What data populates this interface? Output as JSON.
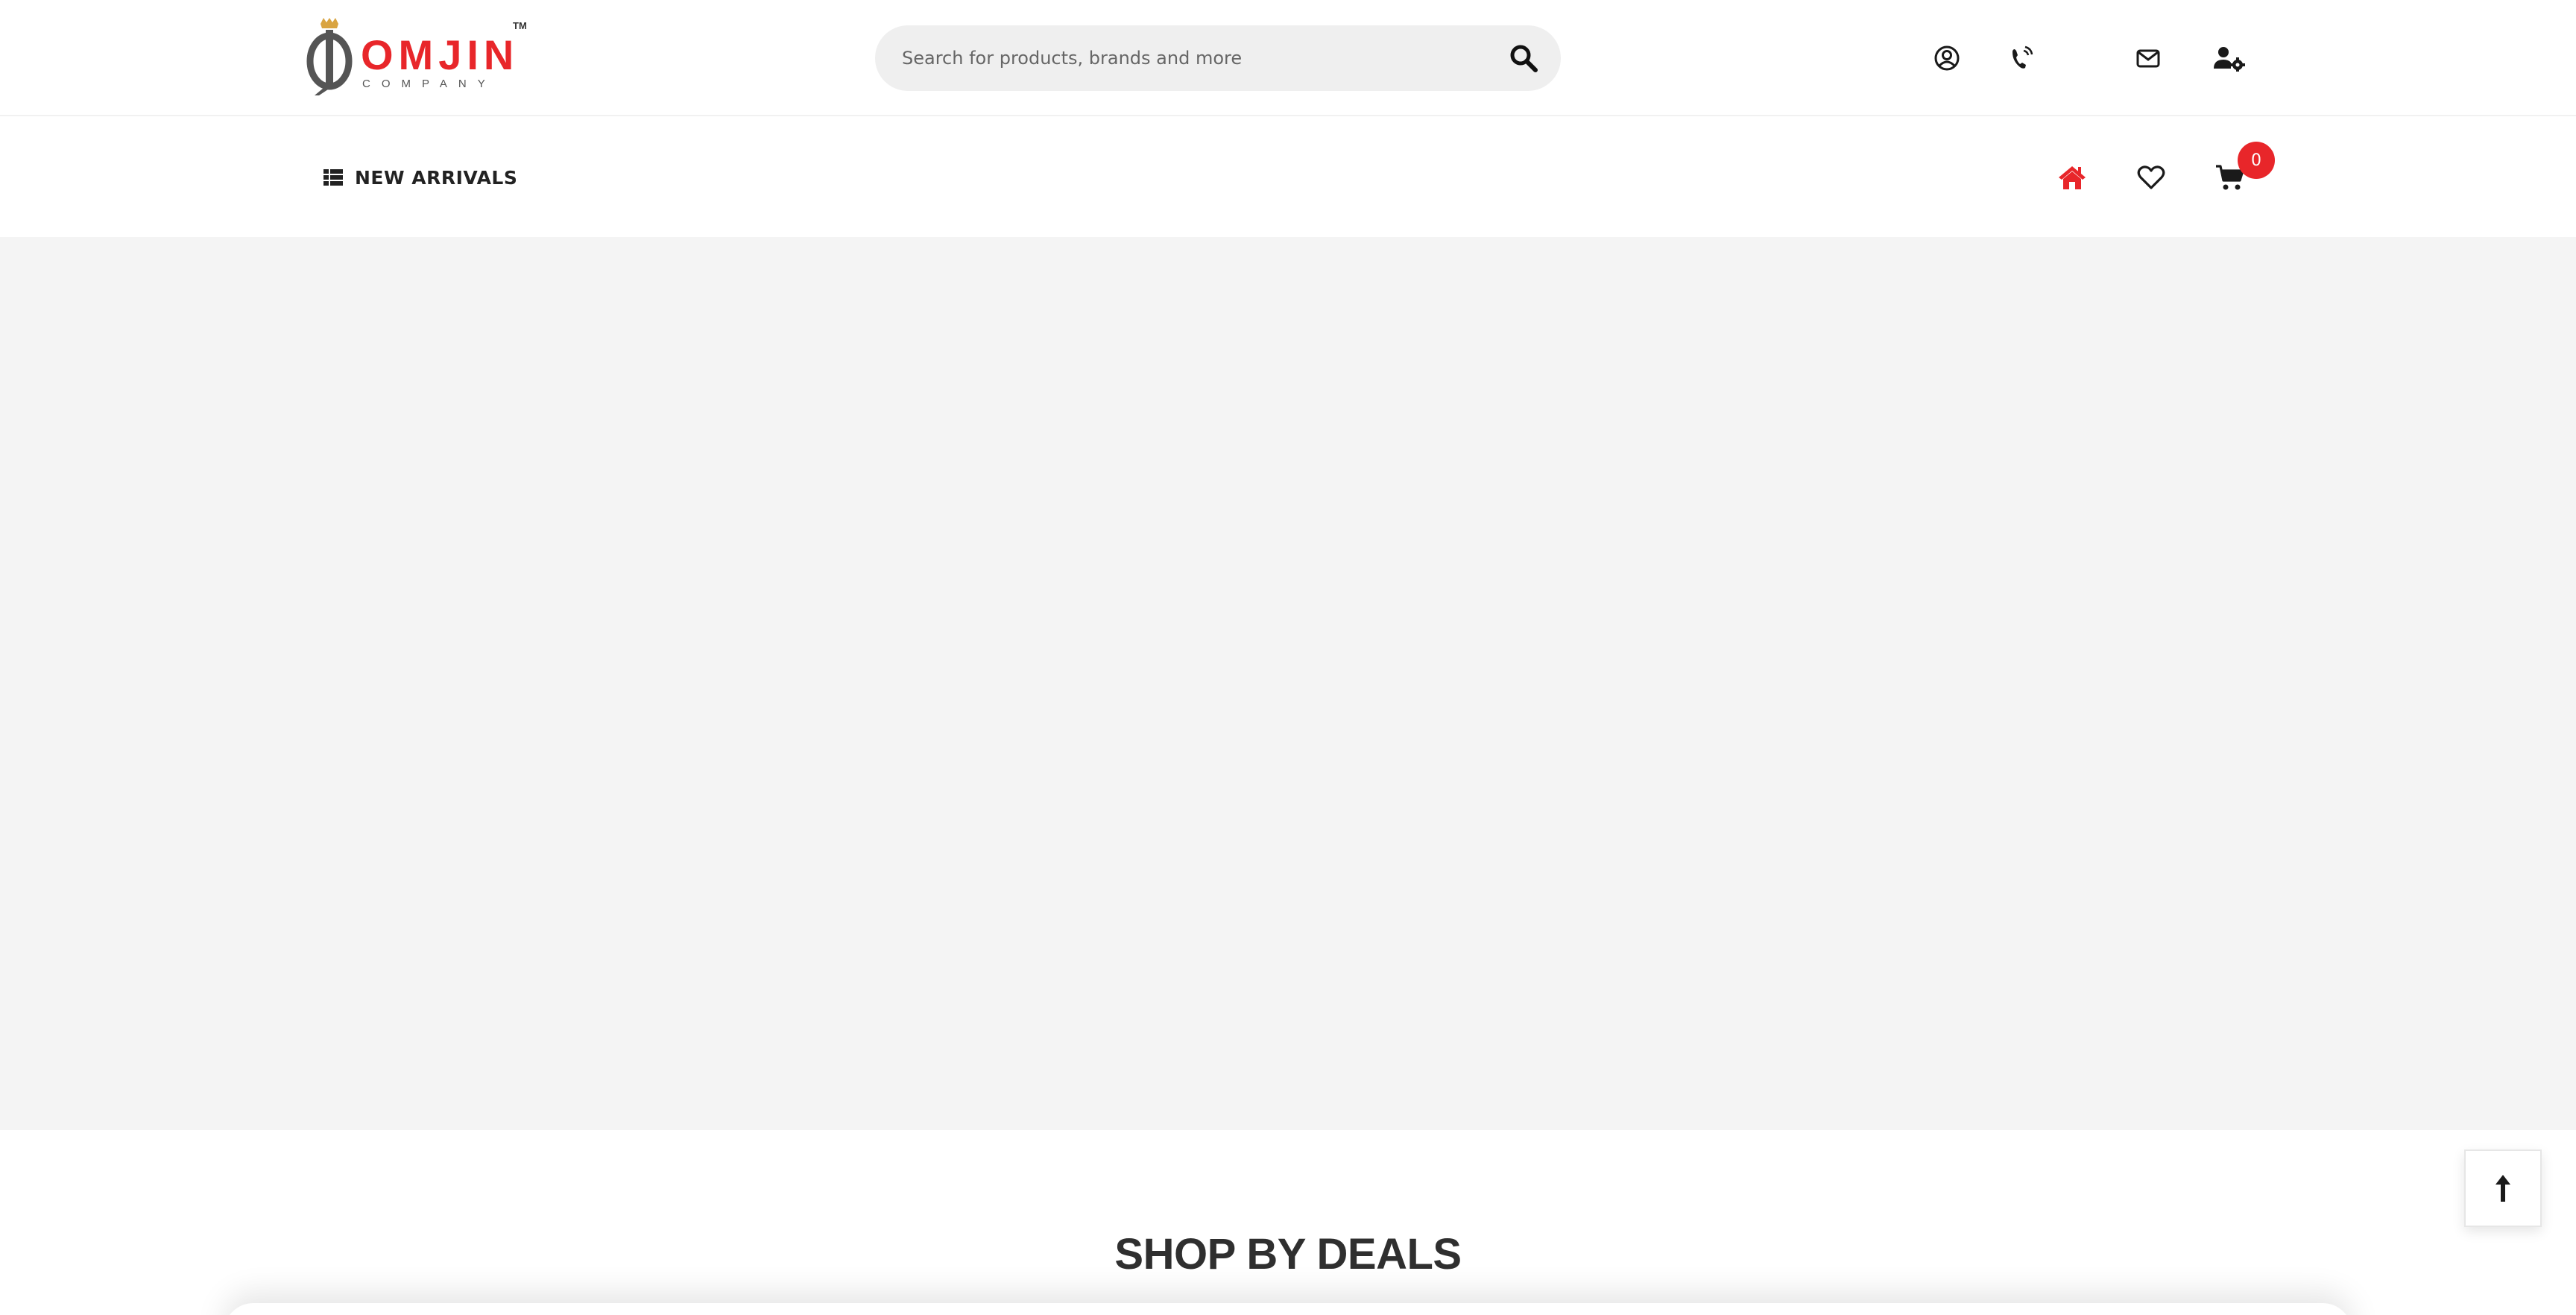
{
  "brand": {
    "name": "OMJIN",
    "sub": "COMPANY",
    "tm": "TM",
    "primary_color": "#e8262a"
  },
  "search": {
    "placeholder": "Search for products, brands and more",
    "icon": "search-icon"
  },
  "header_icons": [
    "user-circle-icon",
    "phone-ring-icon",
    "envelope-icon",
    "user-gear-icon"
  ],
  "nav": {
    "categories_label": "NEW ARRIVALS",
    "categories_icon": "list-icon",
    "icons": [
      "home-icon",
      "heart-icon",
      "cart-icon"
    ],
    "cart_count": "0"
  },
  "deals": {
    "title": "SHOP BY DEALS"
  },
  "scroll_top_icon": "arrow-up-icon"
}
